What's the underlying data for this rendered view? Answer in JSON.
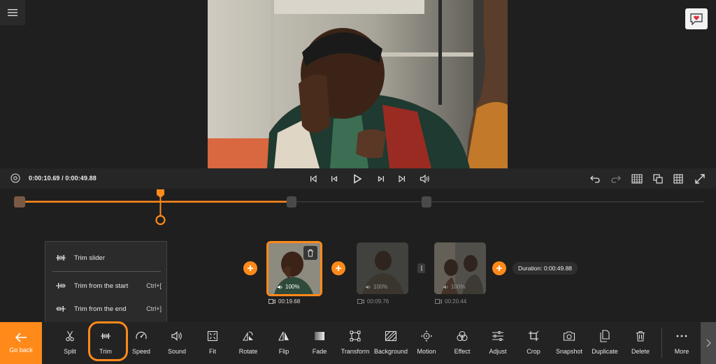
{
  "player": {
    "time_display": "0:00:10.69 / 0:00:49.88"
  },
  "trim_menu": {
    "items": [
      {
        "label": "Trim slider",
        "shortcut": ""
      },
      {
        "label": "Trim from the start",
        "shortcut": "Ctrl+["
      },
      {
        "label": "Trim from the end",
        "shortcut": "Ctrl+]"
      }
    ]
  },
  "timeline": {
    "clips": [
      {
        "volume": "100%",
        "duration": "00:19.68",
        "selected": true
      },
      {
        "volume": "100%",
        "duration": "00:09.76",
        "selected": false
      },
      {
        "volume": "100%",
        "duration": "00:20.44",
        "selected": false
      }
    ],
    "total_duration": "Duration: 0:00:49.88"
  },
  "toolbar": {
    "go_back": "Go back",
    "tools": [
      {
        "label": "Split",
        "icon": "scissors-icon"
      },
      {
        "label": "Trim",
        "icon": "trim-icon"
      },
      {
        "label": "Speed",
        "icon": "speedometer-icon"
      },
      {
        "label": "Sound",
        "icon": "speaker-icon"
      },
      {
        "label": "Fit",
        "icon": "fit-icon"
      },
      {
        "label": "Rotate",
        "icon": "rotate-icon"
      },
      {
        "label": "Flip",
        "icon": "flip-icon"
      },
      {
        "label": "Fade",
        "icon": "fade-icon"
      },
      {
        "label": "Transform",
        "icon": "transform-icon"
      },
      {
        "label": "Background",
        "icon": "background-icon"
      },
      {
        "label": "Motion",
        "icon": "motion-icon"
      },
      {
        "label": "Effect",
        "icon": "effect-icon"
      },
      {
        "label": "Adjust",
        "icon": "adjust-icon"
      },
      {
        "label": "Crop",
        "icon": "crop-icon"
      },
      {
        "label": "Snapshot",
        "icon": "camera-icon"
      },
      {
        "label": "Duplicate",
        "icon": "duplicate-icon"
      },
      {
        "label": "Delete",
        "icon": "trash-icon"
      },
      {
        "label": "More",
        "icon": "more-icon"
      }
    ]
  },
  "colors": {
    "accent": "#ff8a1a",
    "background": "#1f1f1f",
    "panel": "#232323"
  }
}
